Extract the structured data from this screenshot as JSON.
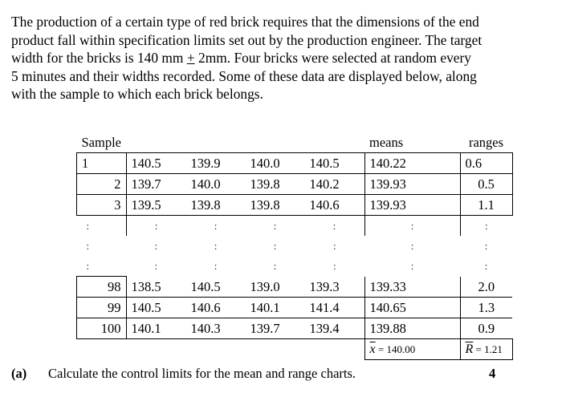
{
  "intro_lines": [
    "The production of a certain type of red brick requires that the dimensions of the end",
    "product fall within specification limits set out by the production engineer.  The target",
    "width for the bricks is 140 mm",
    "2mm.  Four bricks were selected at random every",
    "5 minutes and their widths recorded.  Some of these data are displayed below, along",
    "with the sample to which each brick belongs."
  ],
  "plus_minus": "+",
  "table": {
    "header_sample": "Sample",
    "header_means": "means",
    "header_ranges": "ranges",
    "rows_top": [
      {
        "sample": "1",
        "values": [
          "140.5",
          "139.9",
          "140.0",
          "140.5"
        ],
        "mean": "140.22",
        "range": "0.6"
      },
      {
        "sample": "2",
        "values": [
          "139.7",
          "140.0",
          "139.8",
          "140.2"
        ],
        "mean": "139.93",
        "range": "0.5"
      },
      {
        "sample": "3",
        "values": [
          "139.5",
          "139.8",
          "139.8",
          "140.6"
        ],
        "mean": "139.93",
        "range": "1.1"
      }
    ],
    "dot": ":",
    "rows_bottom": [
      {
        "sample": "98",
        "values": [
          "138.5",
          "140.5",
          "139.0",
          "139.3"
        ],
        "mean": "139.33",
        "range": "2.0"
      },
      {
        "sample": "99",
        "values": [
          "140.5",
          "140.6",
          "140.1",
          "141.4"
        ],
        "mean": "140.65",
        "range": "1.3"
      },
      {
        "sample": "100",
        "values": [
          "140.1",
          "140.3",
          "139.7",
          "139.4"
        ],
        "mean": "139.88",
        "range": "0.9"
      }
    ],
    "grand_mean_symbol": "x",
    "grand_mean_value": "= 140.00",
    "mean_range_symbol": "R",
    "mean_range_value": "= 1.21"
  },
  "question": {
    "label": "(a)",
    "text": "Calculate the control limits for the mean and range charts.",
    "marks": "4"
  }
}
